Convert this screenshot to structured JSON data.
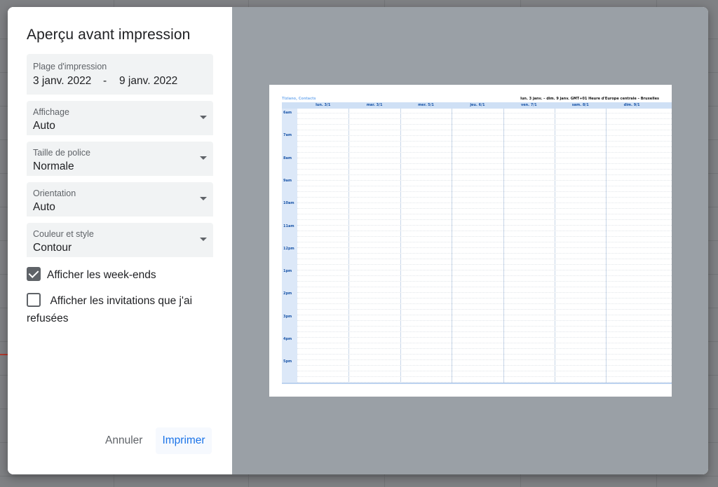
{
  "dialog": {
    "title": "Aperçu avant impression",
    "range": {
      "label": "Plage d'impression",
      "from": "3 janv. 2022",
      "separator": "-",
      "to": "9 janv. 2022"
    },
    "selects": [
      {
        "label": "Affichage",
        "value": "Auto"
      },
      {
        "label": "Taille de police",
        "value": "Normale"
      },
      {
        "label": "Orientation",
        "value": "Auto"
      },
      {
        "label": "Couleur et style",
        "value": "Contour"
      }
    ],
    "checkboxes": [
      {
        "label": "Afficher les week-ends",
        "checked": true
      },
      {
        "label": "Afficher les invitations que j'ai refusées",
        "checked": false
      }
    ],
    "buttons": {
      "cancel": "Annuler",
      "print": "Imprimer"
    }
  },
  "preview": {
    "names": "Tiziano, Contacts",
    "range_text": "lun. 3 janv. – dim. 9 janv. GMT+01 Heure d'Europe centrale – Bruxelles",
    "days": [
      "lun. 3/1",
      "mar. 3/1",
      "mer. 5/1",
      "jeu. 6/1",
      "ven. 7/1",
      "sam. 8/1",
      "dim. 9/1"
    ],
    "hours": [
      "6am",
      "7am",
      "8am",
      "9am",
      "10am",
      "11am",
      "12pm",
      "1pm",
      "2pm",
      "3pm",
      "4pm",
      "5pm"
    ]
  },
  "colors": {
    "accent": "#1a73e8",
    "preview_bg": "#9aa0a6",
    "checkbox": "#5f6368"
  }
}
